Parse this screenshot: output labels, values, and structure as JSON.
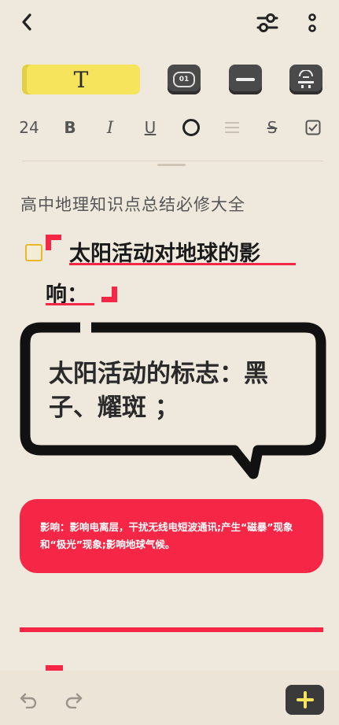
{
  "toolbar": {
    "text_tool_label": "T",
    "counter_label": "01"
  },
  "format": {
    "font_size": "24",
    "bold": "B",
    "italic": "I",
    "underline": "U",
    "strike": "S"
  },
  "doc": {
    "title": "高中地理知识点总结必修大全",
    "heading_line1": "太阳活动对地球的影",
    "heading_line2": "响：",
    "bubble_text": "太阳活动的标志：黑子、耀斑 ；",
    "card_text": "影响：影响电离层，干扰无线电短波通讯;产生“磁暴”现象和“极光”现象;影响地球气候。"
  },
  "colors": {
    "accent_red": "#f62746",
    "highlight_yellow": "#f5e45c",
    "background": "#efe8dc"
  }
}
